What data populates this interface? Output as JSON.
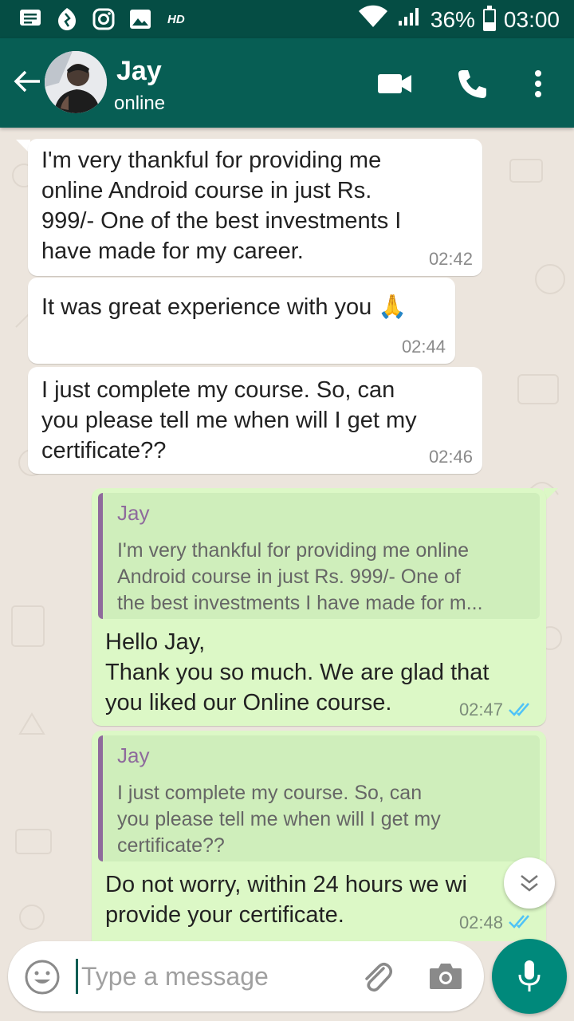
{
  "status_bar": {
    "hd_label": "HD",
    "battery_text": "36%",
    "battery_level": 0.36,
    "time": "03:00"
  },
  "header": {
    "contact_name": "Jay",
    "contact_status": "online"
  },
  "messages": [
    {
      "direction": "incoming",
      "lines": [
        "I'm very thankful for providing me",
        "online Android course in just Rs.",
        "999/- One of the best investments I",
        "have made for my career."
      ],
      "time": "02:42"
    },
    {
      "direction": "incoming",
      "lines": [
        "It was great experience with you 🙏"
      ],
      "time": "02:44"
    },
    {
      "direction": "incoming",
      "lines": [
        "I just complete my course. So, can",
        "you please tell me when will I get my",
        "certificate??"
      ],
      "time": "02:46"
    },
    {
      "direction": "outgoing",
      "quote": {
        "author": "Jay",
        "lines": [
          "I'm very thankful for providing me online",
          "Android course in just Rs. 999/- One of",
          "the best investments I have made for m..."
        ]
      },
      "lines": [
        "Hello Jay,",
        "Thank you so much. We are glad that",
        "you liked our Online course."
      ],
      "time": "02:47",
      "status": "read"
    },
    {
      "direction": "outgoing",
      "quote": {
        "author": "Jay",
        "lines": [
          "I just complete my course. So, can",
          "you please tell me when will I get my",
          "certificate??"
        ]
      },
      "lines": [
        "Do not worry, within 24 hours we wi",
        "provide your certificate."
      ],
      "time": "02:48",
      "status": "read"
    }
  ],
  "input": {
    "placeholder": "Type a message"
  },
  "colors": {
    "header": "#075e54",
    "status_bar": "#054d44",
    "outgoing_bubble": "#dcf8c6",
    "read_ticks": "#4fc3f7",
    "mic_button": "#00897b"
  },
  "icons": {
    "status_bar": [
      "message-icon",
      "flame-icon",
      "instagram-icon",
      "image-icon",
      "wifi-icon",
      "signal-icon",
      "battery-icon"
    ],
    "header": [
      "back-arrow-icon",
      "video-call-icon",
      "phone-icon",
      "more-vertical-icon"
    ],
    "input": [
      "emoji-icon",
      "attach-icon",
      "camera-icon",
      "mic-icon"
    ],
    "chat": [
      "double-chevron-down-icon"
    ]
  }
}
